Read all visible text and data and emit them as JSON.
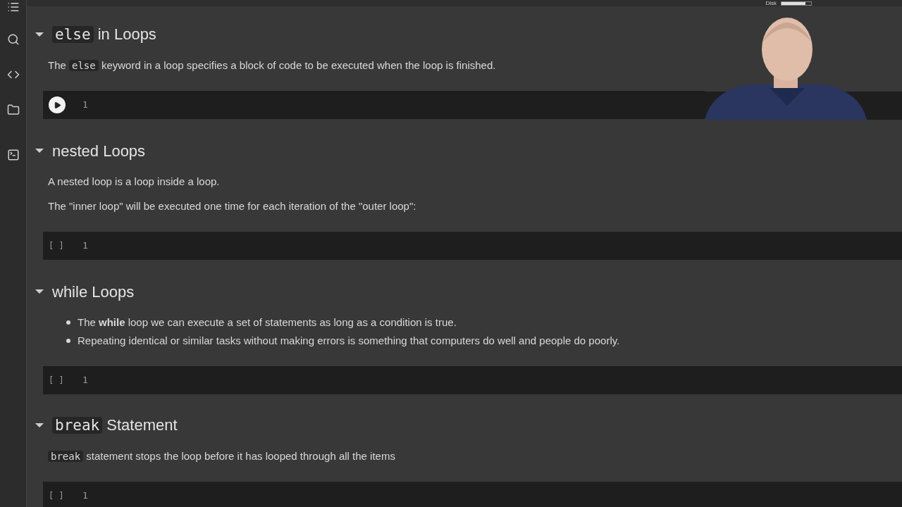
{
  "top_bar": {
    "disk_label": "Disk",
    "disk_meter": {
      "level": 0.8
    }
  },
  "sections": [
    {
      "expanded": true,
      "heading": [
        {
          "kind": "code",
          "text": "else"
        },
        {
          "kind": "text",
          "text": " in Loops"
        }
      ],
      "body": [
        {
          "kind": "paragraph",
          "parts": [
            {
              "kind": "text",
              "text": "The "
            },
            {
              "kind": "code",
              "text": "else"
            },
            {
              "kind": "text",
              "text": " keyword in a loop specifies a block of code to be executed when the loop is finished."
            }
          ]
        }
      ],
      "cell": {
        "kind": "run",
        "line": "1"
      }
    },
    {
      "expanded": true,
      "heading": [
        {
          "kind": "text",
          "text": "nested Loops"
        }
      ],
      "body": [
        {
          "kind": "paragraph",
          "parts": [
            {
              "kind": "text",
              "text": "A nested loop is a loop inside a loop."
            }
          ]
        },
        {
          "kind": "paragraph",
          "parts": [
            {
              "kind": "text",
              "text": "The \"inner loop\" will be executed one time for each iteration of the \"outer loop\":"
            }
          ]
        }
      ],
      "cell": {
        "kind": "idle",
        "marker": "[ ]",
        "line": "1"
      }
    },
    {
      "expanded": true,
      "heading": [
        {
          "kind": "text",
          "text": "while Loops"
        }
      ],
      "body": [
        {
          "kind": "bullets",
          "items": [
            "The **while** loop we can execute a set of statements as long as a condition is true.",
            "Repeating identical or similar tasks without making errors is something that computers do well and people do poorly."
          ]
        }
      ],
      "cell": {
        "kind": "idle",
        "marker": "[ ]",
        "line": "1"
      }
    },
    {
      "expanded": true,
      "heading": [
        {
          "kind": "code",
          "text": "break"
        },
        {
          "kind": "text",
          "text": " Statement"
        }
      ],
      "body": [
        {
          "kind": "paragraph",
          "parts": [
            {
              "kind": "code",
              "text": "break"
            },
            {
              "kind": "text",
              "text": " statement stops the loop before it has looped through all the items"
            }
          ]
        }
      ],
      "cell": {
        "kind": "idle",
        "marker": "[ ]",
        "line": "1"
      }
    }
  ]
}
